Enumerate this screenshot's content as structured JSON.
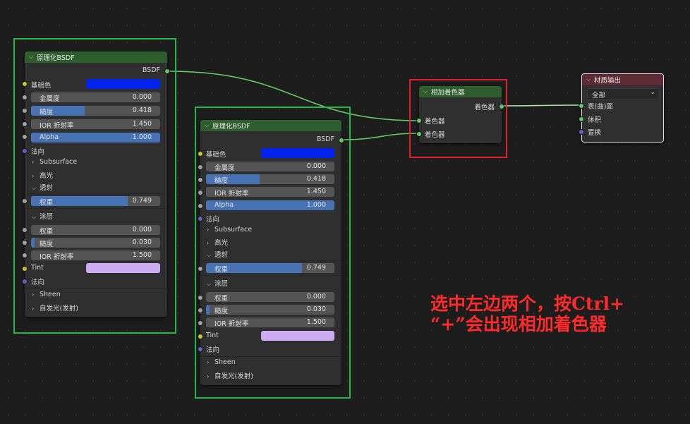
{
  "colors": {
    "selection_green": "#22b84a",
    "annotation_red": "#e0202a",
    "base_color_swatch": "#0022ee",
    "tint_swatch": "#cfaaf5",
    "header_green": "#2e5e2e",
    "header_red": "#5e2a35"
  },
  "node1": {
    "title": "原理化BSDF",
    "output": "BSDF",
    "base_color": "基础色",
    "metallic": {
      "label": "金属度",
      "value": "0.000"
    },
    "roughness": {
      "label": "糙度",
      "value": "0.418",
      "fill": 0.418
    },
    "ior": {
      "label": "IOR 折射率",
      "value": "1.450"
    },
    "alpha": {
      "label": "Alpha",
      "value": "1.000",
      "fill": 1.0
    },
    "normal": "法向",
    "subsurface": "Subsurface",
    "specular": "高光",
    "transmission": "透射",
    "trans_weight": {
      "label": "权重",
      "value": "0.749",
      "fill": 0.749
    },
    "coat": "涂层",
    "coat_weight": {
      "label": "权重",
      "value": "0.000"
    },
    "coat_roughness": {
      "label": "糙度",
      "value": "0.030",
      "fill": 0.03
    },
    "coat_ior": {
      "label": "IOR 折射率",
      "value": "1.500"
    },
    "tint": "Tint",
    "coat_normal": "法向",
    "sheen": "Sheen",
    "emission": "自发光(发射)"
  },
  "node2": {
    "title": "原理化BSDF",
    "output": "BSDF",
    "base_color": "基础色",
    "metallic": {
      "label": "金属度",
      "value": "0.000"
    },
    "roughness": {
      "label": "糙度",
      "value": "0.418",
      "fill": 0.418
    },
    "ior": {
      "label": "IOR 折射率",
      "value": "1.450"
    },
    "alpha": {
      "label": "Alpha",
      "value": "1.000",
      "fill": 1.0
    },
    "normal": "法向",
    "subsurface": "Subsurface",
    "specular": "高光",
    "transmission": "透射",
    "trans_weight": {
      "label": "权重",
      "value": "0.749",
      "fill": 0.749
    },
    "coat": "涂层",
    "coat_weight": {
      "label": "权重",
      "value": "0.000"
    },
    "coat_roughness": {
      "label": "糙度",
      "value": "0.030",
      "fill": 0.03
    },
    "coat_ior": {
      "label": "IOR 折射率",
      "value": "1.500"
    },
    "tint": "Tint",
    "coat_normal": "法向",
    "sheen": "Sheen",
    "emission": "自发光(发射)"
  },
  "add_shader": {
    "title": "相加着色器",
    "output": "着色器",
    "input1": "着色器",
    "input2": "着色器"
  },
  "material_output": {
    "title": "材质输出",
    "target": "全部",
    "surface": "表(曲)面",
    "volume": "体积",
    "displacement": "置换"
  },
  "annotation": {
    "line1": "选中左边两个，按Ctrl+",
    "line2": "“+”会出现相加着色器"
  }
}
